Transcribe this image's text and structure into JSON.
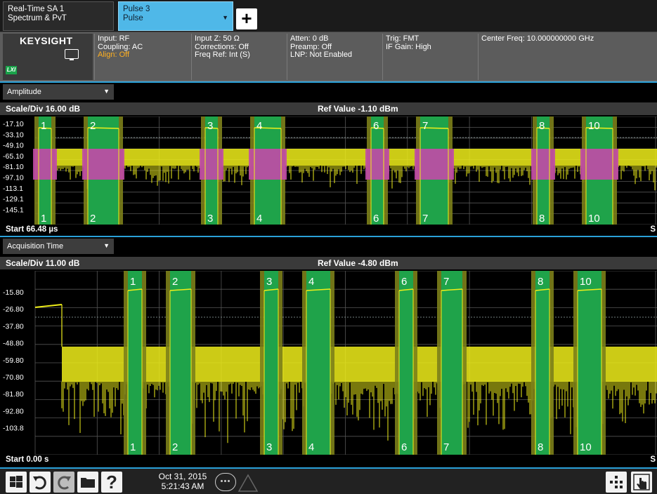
{
  "tabs": {
    "mode_line1": "Real-Time SA 1",
    "mode_line2": "Spectrum & PvT",
    "meas_line1": "Pulse 3",
    "meas_line2": "Pulse",
    "dropdown_glyph": "▼",
    "add_glyph": "+"
  },
  "settings": {
    "logo": "KEYSIGHT",
    "lxi": "LXI",
    "col1": [
      "Input: RF",
      "Coupling: AC",
      "Align: Off"
    ],
    "col2": [
      "Input Z: 50 Ω",
      "Corrections: Off",
      "Freq Ref: Int (S)"
    ],
    "col3": [
      "Atten: 0 dB",
      "Preamp: Off",
      "LNP: Not Enabled"
    ],
    "col4": [
      "Trig: FMT",
      "IF Gain: High"
    ],
    "col5": [
      "Center Freq: 10.000000000 GHz"
    ]
  },
  "window1": {
    "dropdown": "Amplitude",
    "scale": "Scale/Div 16.00 dB",
    "ref": "Ref Value -1.10 dBm",
    "yticks": [
      "-17.10",
      "-33.10",
      "-49.10",
      "-65.10",
      "-81.10",
      "-97.10",
      "-113.1",
      "-129.1",
      "-145.1"
    ],
    "pulse_labels": [
      "1",
      "2",
      "3",
      "4",
      "6",
      "7",
      "8",
      "10"
    ],
    "start": "Start 66.48 µs",
    "stop_partial": "S"
  },
  "window2": {
    "dropdown": "Acquisition Time",
    "scale": "Scale/Div 11.00 dB",
    "ref": "Ref Value -4.80 dBm",
    "yticks": [
      "-15.80",
      "-26.80",
      "-37.80",
      "-48.80",
      "-59.80",
      "-70.80",
      "-81.80",
      "-92.80",
      "-103.8"
    ],
    "pulse_labels": [
      "1",
      "2",
      "3",
      "4",
      "6",
      "7",
      "8",
      "10"
    ],
    "start": "Start 0.00 s",
    "stop_partial": "S"
  },
  "taskbar": {
    "date": "Oct 31, 2015",
    "time": "5:21:43 AM",
    "help_glyph": "?"
  },
  "colors": {
    "trace": "#f0ef1a",
    "pulse_gate": "#1fa34a",
    "pulse_band": "#7c7f1a",
    "magenta": "#c24aa8",
    "accent": "#2aa0d8"
  }
}
